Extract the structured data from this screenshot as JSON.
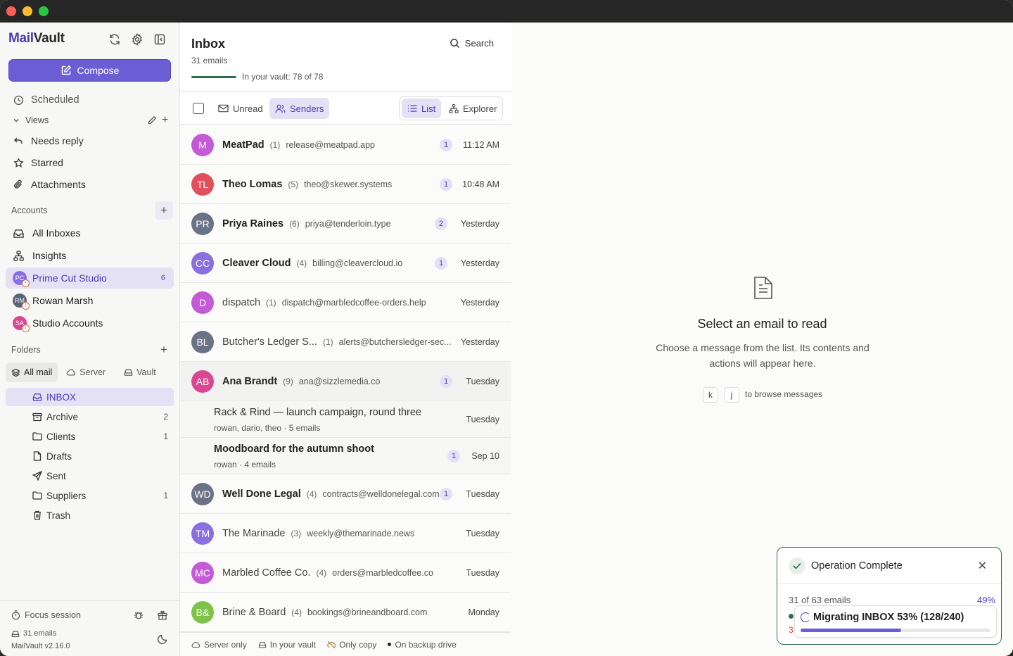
{
  "app": {
    "name_part1": "Mail",
    "name_part2": "Vault"
  },
  "sidebar": {
    "compose_label": "Compose",
    "scheduled_label": "Scheduled",
    "views_label": "Views",
    "views": [
      {
        "label": "Needs reply",
        "icon": "reply-icon"
      },
      {
        "label": "Starred",
        "icon": "star-icon"
      },
      {
        "label": "Attachments",
        "icon": "paperclip-icon"
      }
    ],
    "accounts_label": "Accounts",
    "all_inboxes_label": "All Inboxes",
    "insights_label": "Insights",
    "accounts": [
      {
        "initials": "PC",
        "name": "Prime Cut Studio",
        "count": "6",
        "color": "#8a6fe0",
        "active": true
      },
      {
        "initials": "RM",
        "name": "Rowan Marsh",
        "count": "",
        "color": "#5b6478",
        "active": false
      },
      {
        "initials": "SA",
        "name": "Studio Accounts",
        "count": "",
        "color": "#d9478f",
        "active": false
      }
    ],
    "folders_label": "Folders",
    "folder_tabs": [
      "All mail",
      "Server",
      "Vault"
    ],
    "folders": [
      {
        "label": "INBOX",
        "count": "",
        "icon": "inbox-icon"
      },
      {
        "label": "Archive",
        "count": "2",
        "icon": "archive-icon"
      },
      {
        "label": "Clients",
        "count": "1",
        "icon": "folder-icon"
      },
      {
        "label": "Drafts",
        "count": "",
        "icon": "file-icon"
      },
      {
        "label": "Sent",
        "count": "",
        "icon": "send-icon"
      },
      {
        "label": "Suppliers",
        "count": "1",
        "icon": "folder-icon"
      },
      {
        "label": "Trash",
        "count": "",
        "icon": "trash-icon"
      }
    ],
    "footer": {
      "focus": "Focus session",
      "emails": "31 emails",
      "version": "MailVault v2.16.0"
    }
  },
  "list": {
    "title": "Inbox",
    "subtitle": "31 emails",
    "vault_text": "In your vault: 78 of 78",
    "vault_progress": 1.0,
    "search_label": "Search",
    "filter_unread": "Unread",
    "filter_senders": "Senders",
    "view_list": "List",
    "view_explorer": "Explorer",
    "rows": [
      {
        "type": "sender",
        "initials": "M",
        "color": "#c45ad6",
        "name": "MeatPad",
        "count": "(1)",
        "email": "release@meatpad.app",
        "unread": "1",
        "time": "11:12 AM",
        "bold": true
      },
      {
        "type": "sender",
        "initials": "TL",
        "color": "#e0505a",
        "name": "Theo Lomas",
        "count": "(5)",
        "email": "theo@skewer.systems",
        "unread": "1",
        "time": "10:48 AM",
        "bold": true
      },
      {
        "type": "sender",
        "initials": "PR",
        "color": "#6a7285",
        "name": "Priya Raines",
        "count": "(6)",
        "email": "priya@tenderloin.type",
        "unread": "2",
        "time": "Yesterday",
        "bold": true
      },
      {
        "type": "sender",
        "initials": "CC",
        "color": "#8a6fe0",
        "name": "Cleaver Cloud",
        "count": "(4)",
        "email": "billing@cleavercloud.io",
        "unread": "1",
        "time": "Yesterday",
        "bold": true
      },
      {
        "type": "sender",
        "initials": "D",
        "color": "#c45ad6",
        "name": "dispatch",
        "count": "(1)",
        "email": "dispatch@marbledcoffee-orders.help",
        "unread": "",
        "time": "Yesterday",
        "bold": false
      },
      {
        "type": "sender",
        "initials": "BL",
        "color": "#6a7285",
        "name": "Butcher's Ledger S...",
        "count": "(1)",
        "email": "alerts@butchersledger-sec...",
        "unread": "",
        "time": "Yesterday",
        "bold": false
      },
      {
        "type": "sender",
        "initials": "AB",
        "color": "#d9478f",
        "name": "Ana Brandt",
        "count": "(9)",
        "email": "ana@sizzlemedia.co",
        "unread": "1",
        "time": "Tuesday",
        "bold": true,
        "selected": true
      },
      {
        "type": "thread",
        "subject": "Rack & Rind — launch campaign, round three",
        "meta": "rowan, dario, theo · 5 emails",
        "unread": "",
        "time": "Tuesday",
        "bold": false
      },
      {
        "type": "thread",
        "subject": "Moodboard for the autumn shoot",
        "meta": "rowan · 4 emails",
        "unread": "1",
        "time": "Sep 10",
        "bold": true
      },
      {
        "type": "sender",
        "initials": "WD",
        "color": "#6a7285",
        "name": "Well Done Legal",
        "count": "(4)",
        "email": "contracts@welldonelegal.com",
        "unread": "1",
        "time": "Tuesday",
        "bold": true
      },
      {
        "type": "sender",
        "initials": "TM",
        "color": "#8a6fe0",
        "name": "The Marinade",
        "count": "(3)",
        "email": "weekly@themarinade.news",
        "unread": "",
        "time": "Tuesday",
        "bold": false
      },
      {
        "type": "sender",
        "initials": "MC",
        "color": "#c45ad6",
        "name": "Marbled Coffee Co.",
        "count": "(4)",
        "email": "orders@marbledcoffee.co",
        "unread": "",
        "time": "Tuesday",
        "bold": false
      },
      {
        "type": "sender",
        "initials": "B&",
        "color": "#7fc24a",
        "name": "Brine & Board",
        "count": "(4)",
        "email": "bookings@brineandboard.com",
        "unread": "",
        "time": "Monday",
        "bold": false
      }
    ],
    "legend": [
      "Server only",
      "In your vault",
      "Only copy",
      "On backup drive"
    ]
  },
  "reader": {
    "title": "Select an email to read",
    "description": "Choose a message from the list. Its contents and actions will appear here.",
    "key1": "k",
    "key2": "j",
    "keys_hint": "to browse messages"
  },
  "toast": {
    "title": "Operation Complete",
    "progress_left": "31 of 63 emails",
    "progress_right": "49%",
    "migration_text": "Migrating INBOX 53% (128/240)",
    "migration_progress": 0.53,
    "side_count": "3"
  },
  "colors": {
    "accent": "#6b5dd3",
    "accent_text": "#4b3bb5",
    "success": "#2f6b4f"
  }
}
